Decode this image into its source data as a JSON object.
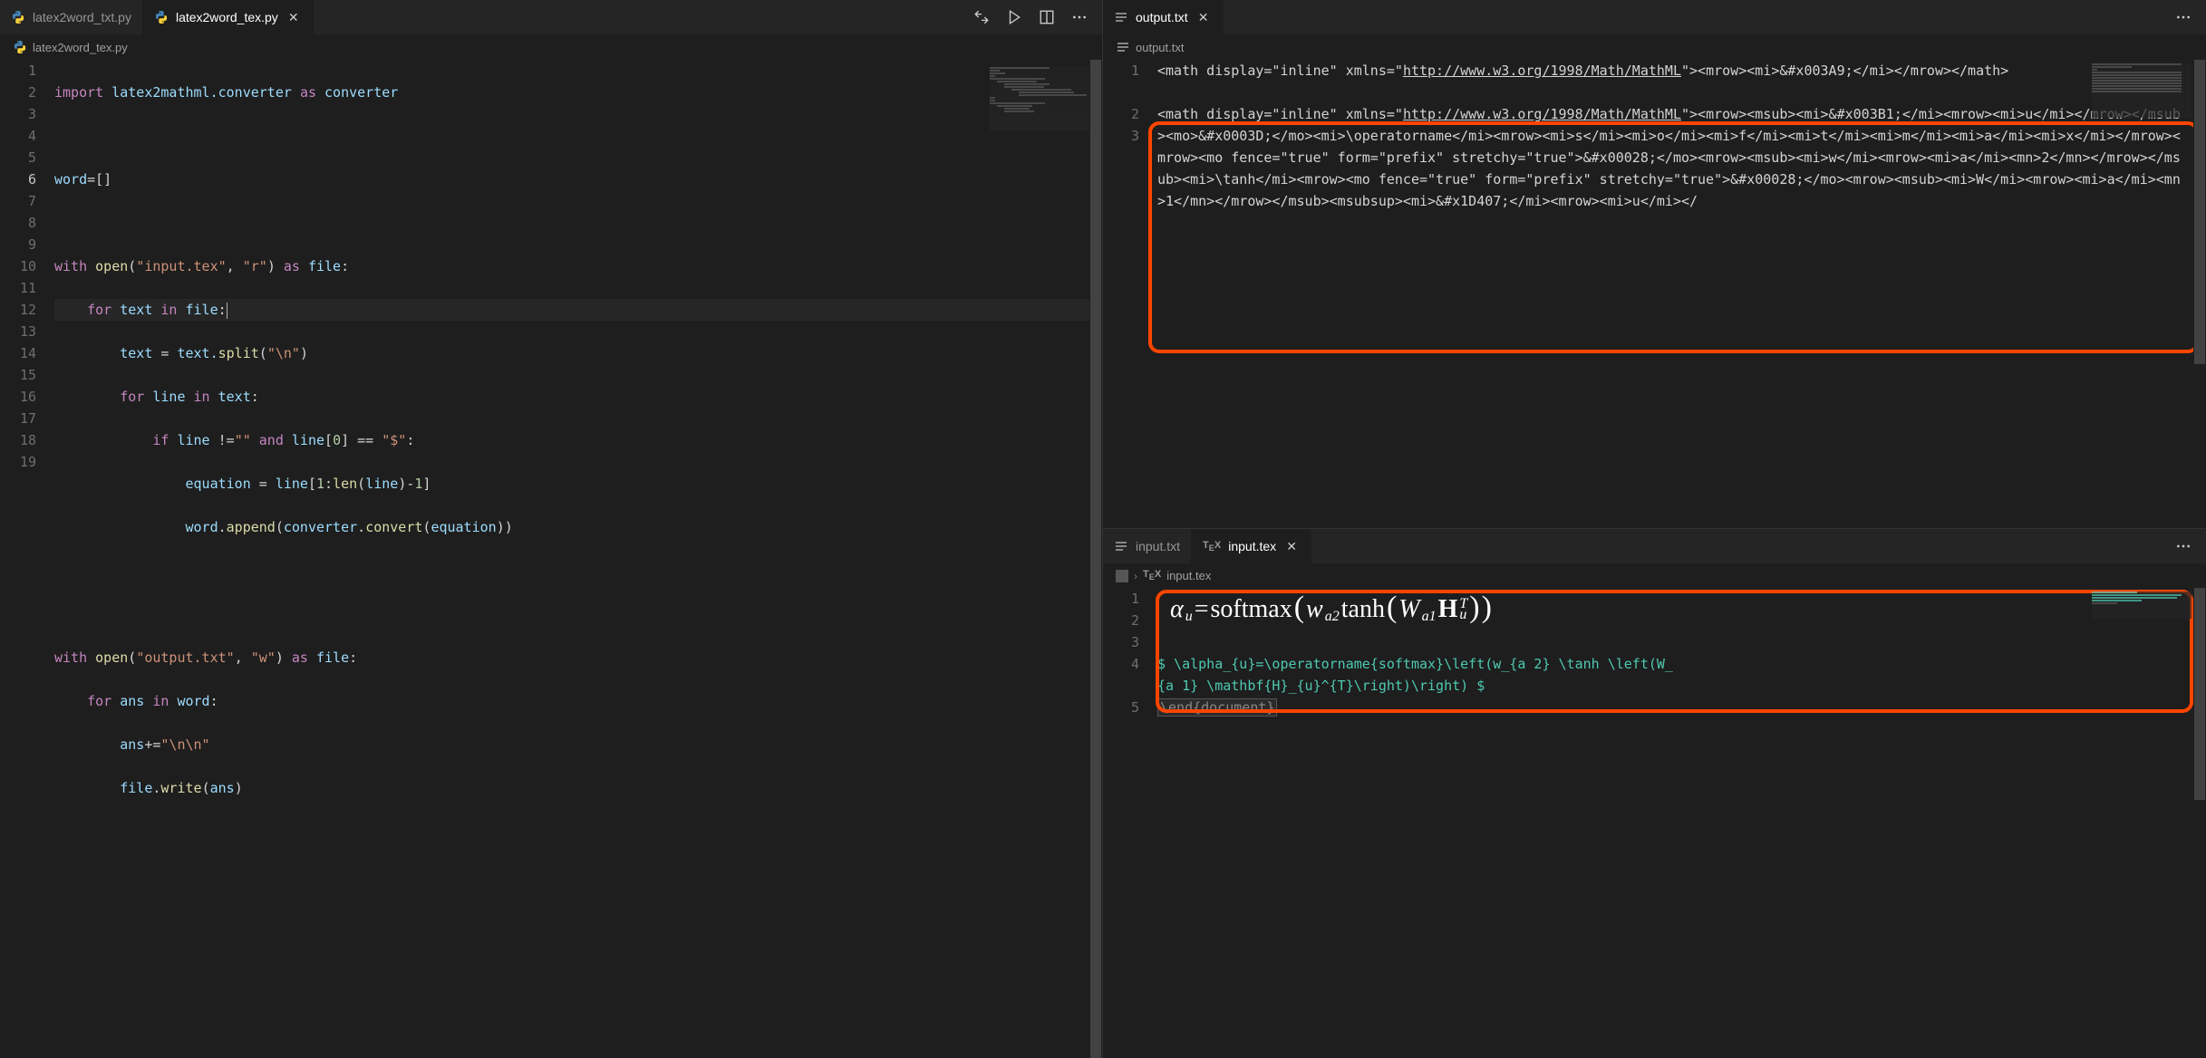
{
  "left": {
    "tabs": [
      {
        "label": "latex2word_txt.py",
        "active": false
      },
      {
        "label": "latex2word_tex.py",
        "active": true
      }
    ],
    "breadcrumb": "latex2word_tex.py",
    "lines": [
      1,
      2,
      3,
      4,
      5,
      6,
      7,
      8,
      9,
      10,
      11,
      12,
      13,
      14,
      15,
      16,
      17,
      18,
      19
    ],
    "active_line": 6,
    "code": {
      "l1": {
        "import": "import",
        "mod": "latex2mathml.converter",
        "as": "as",
        "alias": "converter"
      },
      "l3": {
        "var": "word",
        "assign": "=[]"
      },
      "l5": {
        "with": "with",
        "open": "open",
        "arg1": "\"input.tex\"",
        "comma": ", ",
        "arg2": "\"r\"",
        "as": "as",
        "f": "file",
        "colon": ":"
      },
      "l6": {
        "for": "for",
        "v": "text",
        "in": "in",
        "it": "file",
        "colon": ":"
      },
      "l7": {
        "v": "text",
        "assign": " = ",
        "expr1": "text.",
        "fn": "split",
        "arg": "(\"\\n\")"
      },
      "l8": {
        "for": "for",
        "v": "line",
        "in": "in",
        "it": "text",
        "colon": ":"
      },
      "l9": {
        "if": "if",
        "v": "line",
        "neq": " !=",
        "empty": "\"\"",
        "and": "and",
        "v2": "line[",
        "idx": "0",
        "close": "] == ",
        "dollar": "\"$\"",
        "colon": ":"
      },
      "l10": {
        "v": "equation",
        "assign": " = ",
        "expr": "line[",
        "n1": "1",
        "mid": ":",
        "fn": "len",
        "paren": "(line)-",
        "n2": "1",
        "end": "]"
      },
      "l11": {
        "expr": "word.",
        "fn1": "append",
        "p1": "(",
        "obj": "converter.",
        "fn2": "convert",
        "p2": "(equation))"
      },
      "l14": {
        "with": "with",
        "open": "open",
        "arg1": "\"output.txt\"",
        "comma": ", ",
        "arg2": "\"w\"",
        "as": "as",
        "f": "file",
        "colon": ":"
      },
      "l15": {
        "for": "for",
        "v": "ans",
        "in": "in",
        "it": "word",
        "colon": ":"
      },
      "l16": {
        "v": "ans",
        "assign": "+=",
        "str": "\"\\n\\n\""
      },
      "l17": {
        "obj": "file.",
        "fn": "write",
        "arg": "(ans)"
      }
    }
  },
  "rtop": {
    "tabs": [
      {
        "label": "output.txt",
        "active": true
      }
    ],
    "breadcrumb": "output.txt",
    "line1_a": "<math display=\"inline\" xmlns=\"",
    "line1_url": "http://www.w3.org/1998/Math/MathML",
    "line1_b": "\"><mrow><mi>&#x003A9;</mi></mrow></math>",
    "line3_a": "<math display=\"inline\" xmlns=\"",
    "line3_url": "http://www.w3.org/1998/Math/MathML",
    "line3_b": "\"><mrow><msub><mi>&#x003B1;</mi><mrow><mi>u</mi></mrow></msub><mo>&#x0003D;</mo><mi>\\operatorname</mi><mrow><mi>s</mi><mi>o</mi><mi>f</mi><mi>t</mi><mi>m</mi><mi>a</mi><mi>x</mi></mrow><mrow><mo fence=\"true\" form=\"prefix\" stretchy=\"true\">&#x00028;</mo><mrow><msub><mi>w</mi><mrow><mi>a</mi><mn>2</mn></mrow></msub><mi>\\tanh</mi><mrow><mo fence=\"true\" form=\"prefix\" stretchy=\"true\">&#x00028;</mo><mrow><msub><mi>W</mi><mrow><mi>a</mi><mn>1</mn></mrow></msub><msubsup><mi>&#x1D407;</mi><mrow><mi>u</mi></"
  },
  "rbot": {
    "tabs": [
      {
        "label": "input.txt",
        "active": false
      },
      {
        "label": "input.tex",
        "active": true
      }
    ],
    "breadcrumb": "input.tex",
    "formula": {
      "alpha": "α",
      "sub_u": "u",
      "eq": " = ",
      "softmax": "softmax",
      "lp1": "(",
      "w": "w",
      "sub_a2": "a2",
      "tanh": " tanh",
      "lp2": "(",
      "W": "W",
      "sub_a1": "a1",
      "H": "H",
      "sup_T": "T",
      "sub_u2": "u",
      "rp2": ")",
      "rp1": ")"
    },
    "latex_line4_a": "$ \\alpha_{u}=\\operatorname{softmax}\\left(w_{a 2} \\tanh \\left(W_",
    "latex_line4_b": "{a 1} \\mathbf{H}_{u}^{T}\\right)\\right)  $",
    "latex_line5": "\\end{document}"
  }
}
